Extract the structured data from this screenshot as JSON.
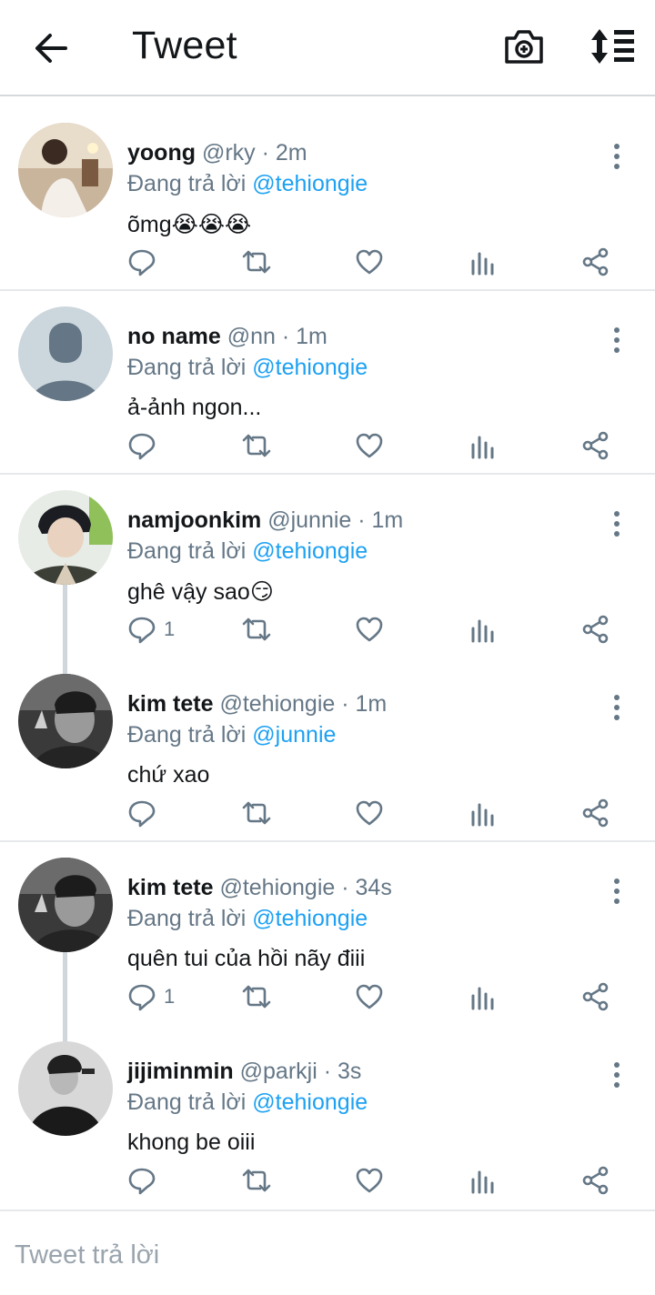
{
  "header": {
    "title": "Tweet",
    "back_icon": "arrow-left-icon",
    "camera_icon": "camera-plus-icon",
    "sort_icon": "sort-list-icon"
  },
  "reply_prefix": "Đang trả lời",
  "tweets": [
    {
      "name": "yoong",
      "meta": "@rky · 2m",
      "mention": "@tehiongie",
      "text": "õmg😭😭😭",
      "reply_count": ""
    },
    {
      "name": "no name",
      "meta": "@nn · 1m",
      "mention": "@tehiongie",
      "text": "ả-ảnh ngon...",
      "reply_count": ""
    },
    {
      "name": "namjoonkim",
      "meta": "@junnie · 1m",
      "mention": "@tehiongie",
      "text": "ghê vậy sao😏",
      "reply_count": "1"
    },
    {
      "name": "kim tete",
      "meta": "@tehiongie · 1m",
      "mention": "@junnie",
      "text": "chứ xao",
      "reply_count": ""
    },
    {
      "name": "kim tete",
      "meta": "@tehiongie · 34s",
      "mention": "@tehiongie",
      "text": "quên tui của hồi nãy điii",
      "reply_count": "1"
    },
    {
      "name": "jijiminmin",
      "meta": "@parkji · 3s",
      "mention": "@tehiongie",
      "text": "khong be oiii",
      "reply_count": ""
    }
  ],
  "composer": {
    "placeholder": "Tweet trả lời"
  },
  "colors": {
    "accent": "#1da1f2",
    "muted": "#657786",
    "divider": "#e6e9ec"
  }
}
